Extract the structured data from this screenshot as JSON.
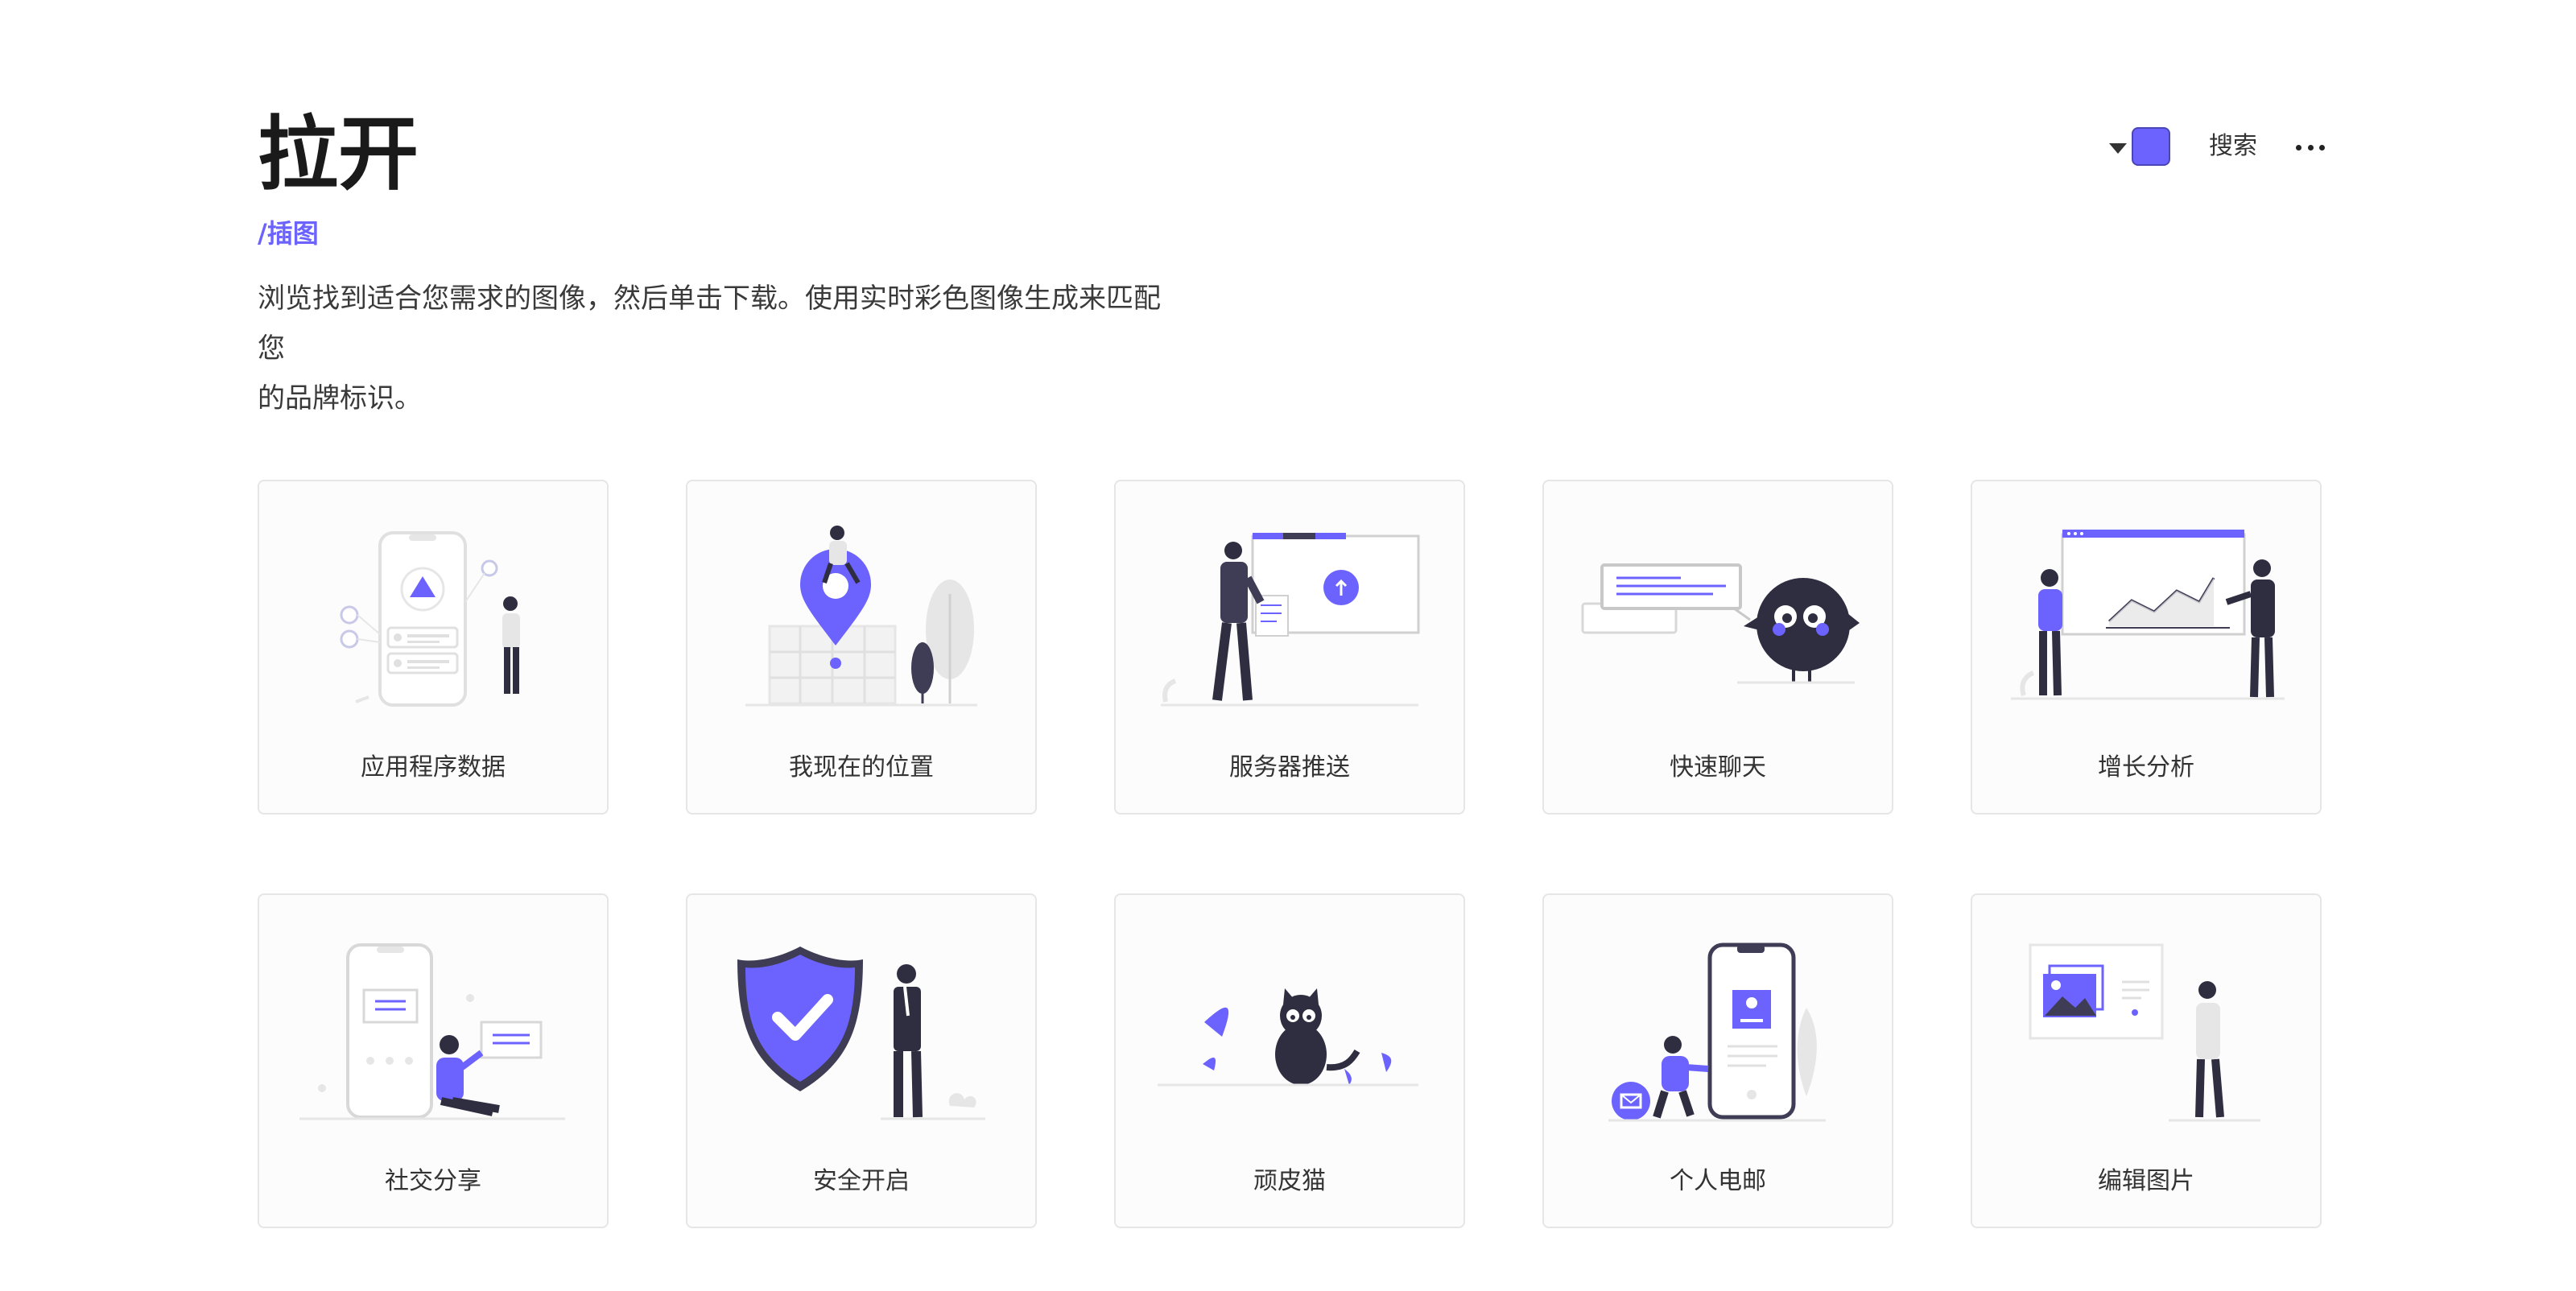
{
  "header": {
    "title": "拉开",
    "breadcrumb": "/插图",
    "description_line1": "浏览找到适合您需求的图像，然后单击下载。使用实时彩色图像生成来匹配您",
    "description_line2": "的品牌标识。"
  },
  "controls": {
    "color_swatch": "#6c63ff",
    "search_label": "搜索",
    "more_icon": "more-horizontal-icon",
    "caret_icon": "caret-down-icon"
  },
  "colors": {
    "accent": "#6c63ff",
    "dark": "#3f3d56",
    "gray": "#e6e6e6"
  },
  "illustrations": [
    {
      "label": "应用程序数据"
    },
    {
      "label": "我现在的位置"
    },
    {
      "label": "服务器推送"
    },
    {
      "label": "快速聊天"
    },
    {
      "label": "增长分析"
    },
    {
      "label": "社交分享"
    },
    {
      "label": "安全开启"
    },
    {
      "label": "顽皮猫"
    },
    {
      "label": "个人电邮"
    },
    {
      "label": "编辑图片"
    }
  ]
}
